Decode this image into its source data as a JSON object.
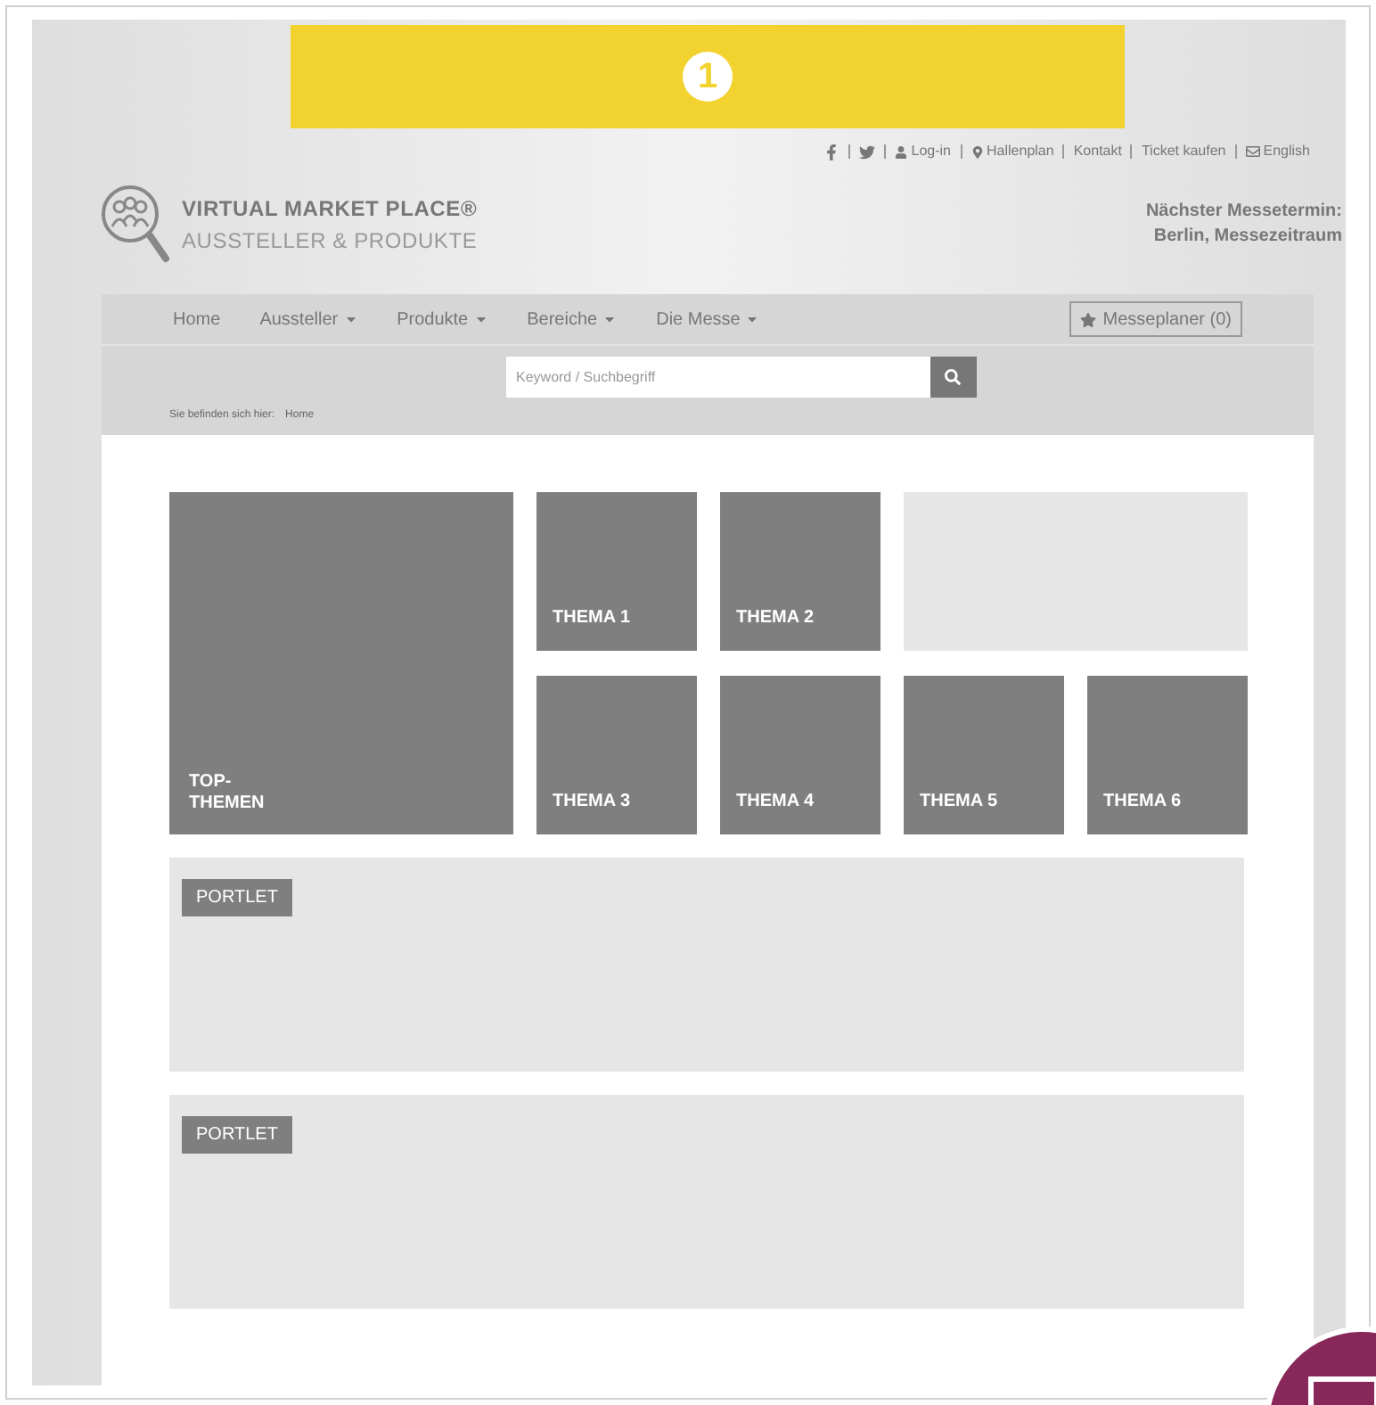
{
  "banner": {
    "step": "1"
  },
  "top_links": [
    {
      "kind": "facebook"
    },
    {
      "kind": "twitter"
    },
    {
      "kind": "user",
      "label": "Log-in"
    },
    {
      "kind": "pin",
      "label": "Hallenplan"
    },
    {
      "kind": "text",
      "label": "Kontakt"
    },
    {
      "kind": "text",
      "label": "Ticket kaufen"
    },
    {
      "kind": "language",
      "label": "English"
    }
  ],
  "brand": {
    "title": "VIRTUAL MARKET PLACE®",
    "subtitle": "AUSSTELLER & PRODUKTE"
  },
  "next_event": {
    "line1": "Nächster Messetermin:",
    "line2": "Berlin, Messezeitraum"
  },
  "nav": [
    {
      "label": "Home",
      "dropdown": false
    },
    {
      "label": "Aussteller",
      "dropdown": true
    },
    {
      "label": "Produkte",
      "dropdown": true
    },
    {
      "label": "Bereiche",
      "dropdown": true
    },
    {
      "label": "Die Messe",
      "dropdown": true
    }
  ],
  "planner": {
    "label": "Messeplaner (0)"
  },
  "search": {
    "placeholder": "Keyword / Suchbegriff"
  },
  "breadcrumb": {
    "prefix": "Sie befinden sich hier:",
    "current": "Home"
  },
  "tiles": [
    {
      "kind": "top",
      "label": "TOP-\nTHEMEN"
    },
    {
      "kind": "theme",
      "label": "THEMA 1"
    },
    {
      "kind": "theme",
      "label": "THEMA 2"
    },
    {
      "kind": "empty"
    },
    {
      "kind": "theme",
      "label": "THEMA 3"
    },
    {
      "kind": "theme",
      "label": "THEMA 4"
    },
    {
      "kind": "theme",
      "label": "THEMA 5"
    },
    {
      "kind": "theme",
      "label": "THEMA 6"
    }
  ],
  "portlets": [
    {
      "label": "PORTLET"
    },
    {
      "label": "PORTLET"
    }
  ]
}
